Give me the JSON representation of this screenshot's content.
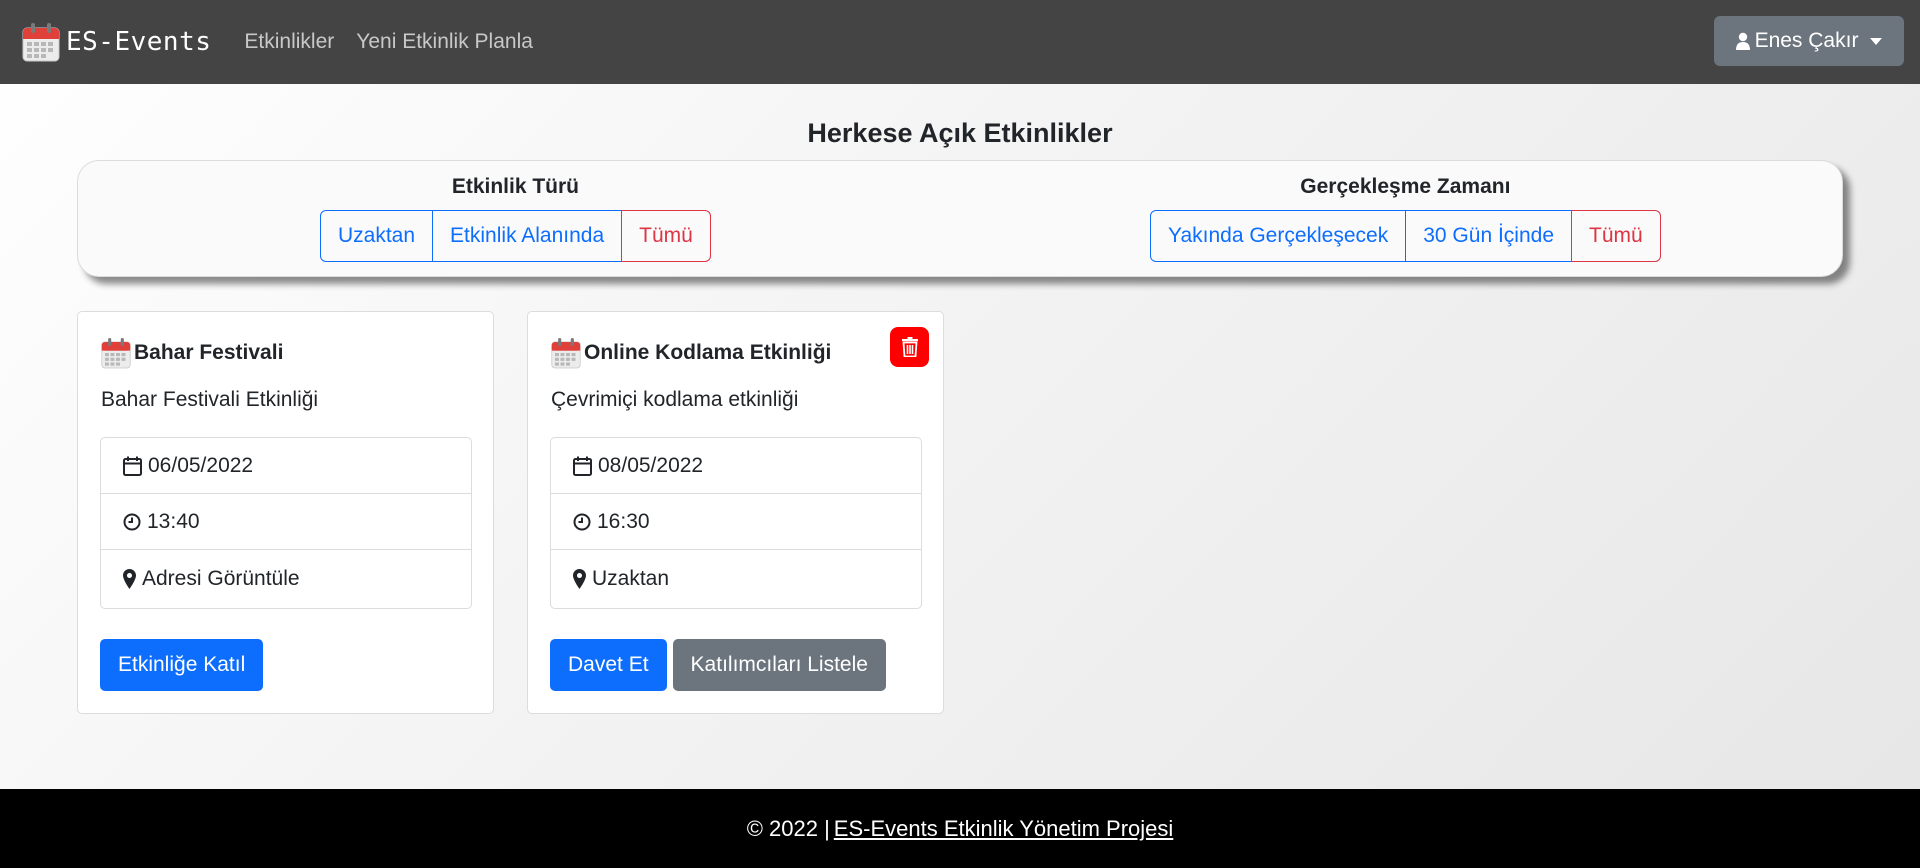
{
  "navbar": {
    "brand": "ES-Events",
    "links": [
      "Etkinlikler",
      "Yeni Etkinlik Planla"
    ],
    "user_name": "Enes Çakır"
  },
  "page_title": "Herkese Açık Etkinlikler",
  "filters": {
    "type": {
      "label": "Etkinlik Türü",
      "options": [
        "Uzaktan",
        "Etkinlik Alanında",
        "Tümü"
      ]
    },
    "time": {
      "label": "Gerçekleşme Zamanı",
      "options": [
        "Yakında Gerçekleşecek",
        "30 Gün İçinde",
        "Tümü"
      ]
    }
  },
  "events": [
    {
      "title": "Bahar Festivali",
      "description": "Bahar Festivali Etkinliği",
      "date": "06/05/2022",
      "time": "13:40",
      "location": "Adresi Görüntüle",
      "buttons": [
        "Etkinliğe Katıl"
      ]
    },
    {
      "title": "Online Kodlama Etkinliği",
      "description": "Çevrimiçi kodlama etkinliği",
      "date": "08/05/2022",
      "time": "16:30",
      "location": "Uzaktan",
      "buttons": [
        "Davet Et",
        "Katılımcıları Listele"
      ]
    }
  ],
  "footer": {
    "prefix": "© 2022 |",
    "link": "ES-Events Etkinlik Yönetim Projesi"
  },
  "colors": {
    "navbar": "#444444",
    "primary": "#0d6efd",
    "danger": "#dc3545",
    "secondary": "#6c757d",
    "delete": "#ff0000",
    "footer": "#000000"
  }
}
